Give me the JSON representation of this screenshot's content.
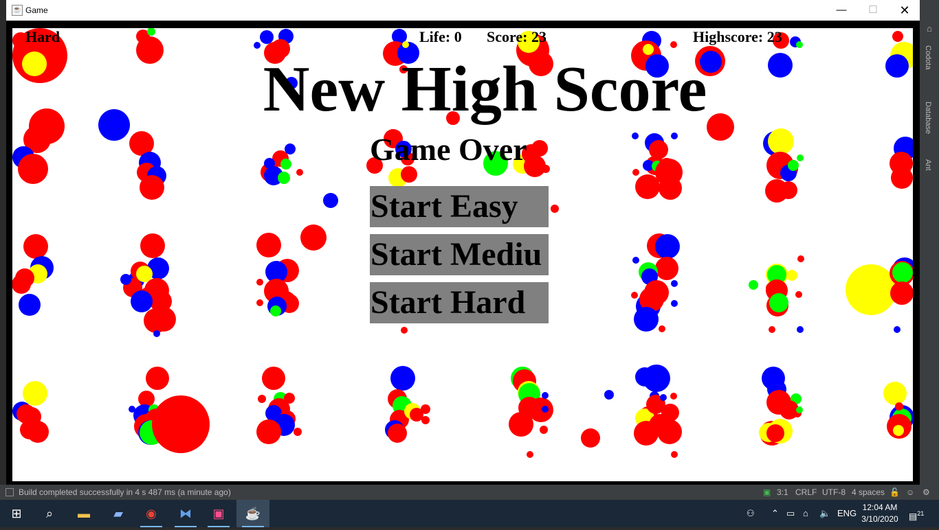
{
  "window": {
    "title": "Game"
  },
  "hud": {
    "difficulty": "Hard",
    "life": "Life: 0",
    "score": "Score: 23",
    "highscore": "Highscore: 23"
  },
  "banner": {
    "title": "New High Score",
    "subtitle": "Game Over"
  },
  "menu": {
    "start_easy": "Start Easy",
    "start_medium": "Start Mediu",
    "start_hard": "Start Hard"
  },
  "ide": {
    "right_tabs": [
      "Codota",
      "Database",
      "Ant"
    ],
    "status_message": "Build completed successfully in 4 s 487 ms (a minute ago)",
    "cursor_pos": "3:1",
    "line_sep": "CRLF",
    "encoding": "UTF-8",
    "indent": "4 spaces"
  },
  "taskbar": {
    "language": "ENG",
    "time": "12:04 AM",
    "date": "3/10/2020",
    "notifications": "21"
  },
  "colors": {
    "red": "#ff0000",
    "blue": "#0000ff",
    "yellow": "#ffff00",
    "green": "#00ff00",
    "button": "#808080"
  }
}
